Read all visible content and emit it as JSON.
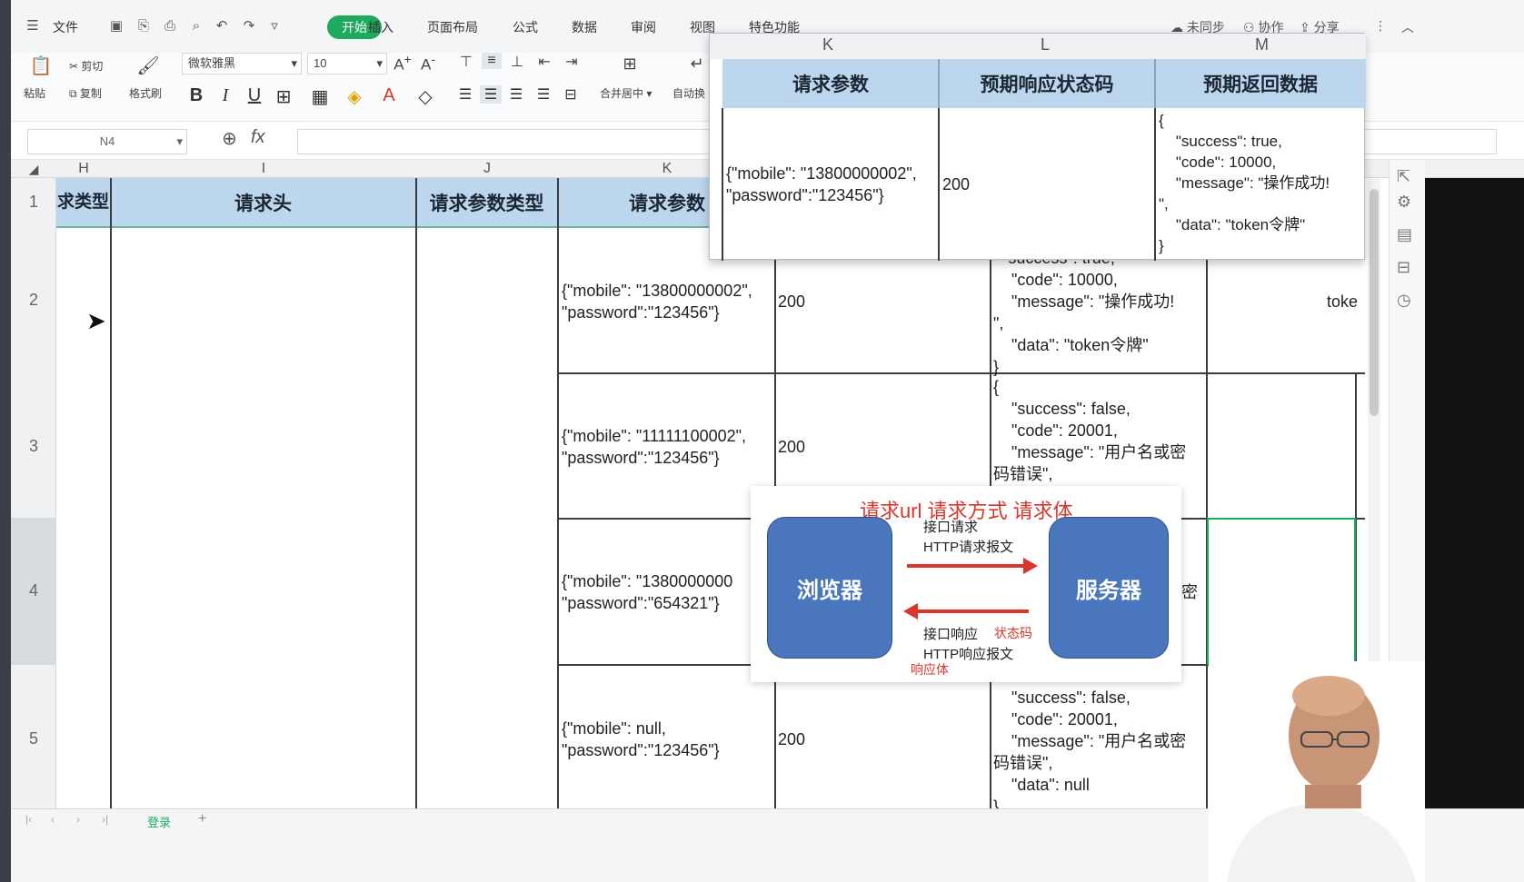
{
  "menubar": {
    "items": [
      "文件",
      "开始",
      "插入",
      "页面布局",
      "公式",
      "数据",
      "审阅",
      "视图",
      "特色功能"
    ],
    "active": "开始",
    "right": [
      "未同步",
      "协作",
      "分享"
    ]
  },
  "ribbon": {
    "paste": "粘贴",
    "cut": "剪切",
    "copy": "复制",
    "format_painter": "格式刷",
    "font_name": "微软雅黑",
    "font_size": "10",
    "merge_center": "合并居中",
    "auto_wrap": "自动换"
  },
  "formula_bar": {
    "cell_ref": "N4",
    "fx": "fx",
    "value": ""
  },
  "column_headers": [
    "H",
    "I",
    "J",
    "K"
  ],
  "row_numbers": [
    "1",
    "2",
    "3",
    "4",
    "5"
  ],
  "header_row": {
    "h": "求类型",
    "i": "请求头",
    "j": "请求参数类型",
    "k": "请求参数"
  },
  "rows": [
    {
      "k": "{\"mobile\": \"13800000002\",\n\"password\":\"123456\"}",
      "l": "200",
      "m": "  \"success\": true,\n    \"code\": 10000,\n    \"message\": \"操作成功!\n\",\n    \"data\": \"token令牌\"\n}",
      "n": "toke"
    },
    {
      "k": "{\"mobile\": \"11111100002\",\n\"password\":\"123456\"}",
      "l": "200",
      "m": "{\n    \"success\": false,\n    \"code\": 20001,\n    \"message\": \"用户名或密\n码错误\","
    },
    {
      "k": "{\"mobile\": \"1380000000\n\"password\":\"654321\"}",
      "l": "",
      "m": "密"
    },
    {
      "k": "{\"mobile\": null,\n\"password\":\"123456\"}",
      "l": "200",
      "m": "    \"success\": false,\n    \"code\": 20001,\n    \"message\": \"用户名或密\n码错误\",\n    \"data\": null\n}"
    }
  ],
  "popup": {
    "col_letters": [
      "K",
      "L",
      "M"
    ],
    "headers": [
      "请求参数",
      "预期响应状态码",
      "预期返回数据"
    ],
    "k": "{\"mobile\": \"13800000002\",\n\"password\":\"123456\"}",
    "l": "200",
    "m": "{\n    \"success\": true,\n    \"code\": 10000,\n    \"message\": \"操作成功!\n\",\n    \"data\": \"token令牌\"\n}"
  },
  "diagram": {
    "title": "请求url  请求方式  请求体",
    "left_box": "浏览器",
    "right_box": "服务器",
    "req_label1": "接口请求",
    "req_label2": "HTTP请求报文",
    "resp_label1": "接口响应",
    "resp_status": "状态码",
    "resp_label2": "HTTP响应报文",
    "resp_body": "响应体"
  },
  "sheet_tab": "登录",
  "colors": {
    "accent_green": "#1eaa5c",
    "header_blue": "#bcd6ee",
    "diagram_blue": "#4a76bd",
    "diagram_red": "#d9362b"
  }
}
